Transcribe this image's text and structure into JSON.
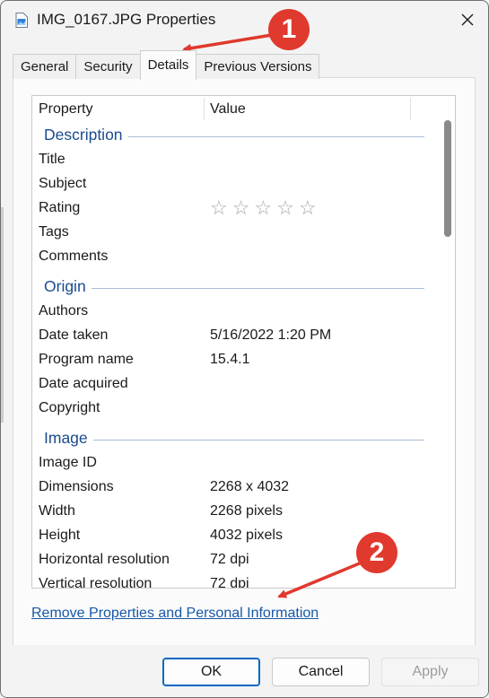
{
  "window": {
    "title": "IMG_0167.JPG Properties"
  },
  "tabs": [
    {
      "label": "General"
    },
    {
      "label": "Security"
    },
    {
      "label": "Details"
    },
    {
      "label": "Previous Versions"
    }
  ],
  "details": {
    "columns": {
      "property": "Property",
      "value": "Value"
    },
    "groups": {
      "description": "Description",
      "origin": "Origin",
      "image": "Image"
    },
    "rows": {
      "title": {
        "k": "Title",
        "v": ""
      },
      "subject": {
        "k": "Subject",
        "v": ""
      },
      "rating": {
        "k": "Rating",
        "stars": [
          "☆",
          "☆",
          "☆",
          "☆",
          "☆"
        ]
      },
      "tags": {
        "k": "Tags",
        "v": ""
      },
      "comments": {
        "k": "Comments",
        "v": ""
      },
      "authors": {
        "k": "Authors",
        "v": ""
      },
      "date_taken": {
        "k": "Date taken",
        "v": "5/16/2022 1:20 PM"
      },
      "program_name": {
        "k": "Program name",
        "v": "15.4.1"
      },
      "date_acquired": {
        "k": "Date acquired",
        "v": ""
      },
      "copyright": {
        "k": "Copyright",
        "v": ""
      },
      "image_id": {
        "k": "Image ID",
        "v": ""
      },
      "dimensions": {
        "k": "Dimensions",
        "v": "2268 x 4032"
      },
      "width": {
        "k": "Width",
        "v": "2268 pixels"
      },
      "height": {
        "k": "Height",
        "v": "4032 pixels"
      },
      "h_res": {
        "k": "Horizontal resolution",
        "v": "72 dpi"
      },
      "v_res": {
        "k": "Vertical resolution",
        "v": "72 dpi"
      }
    }
  },
  "link": {
    "remove": "Remove Properties and Personal Information"
  },
  "buttons": {
    "ok": "OK",
    "cancel": "Cancel",
    "apply": "Apply"
  },
  "annotations": {
    "badge1": "1",
    "badge2": "2"
  },
  "colors": {
    "accent": "#0067c0",
    "group": "#1a4a8e",
    "link": "#1658a8",
    "annotation": "#e0392e"
  }
}
